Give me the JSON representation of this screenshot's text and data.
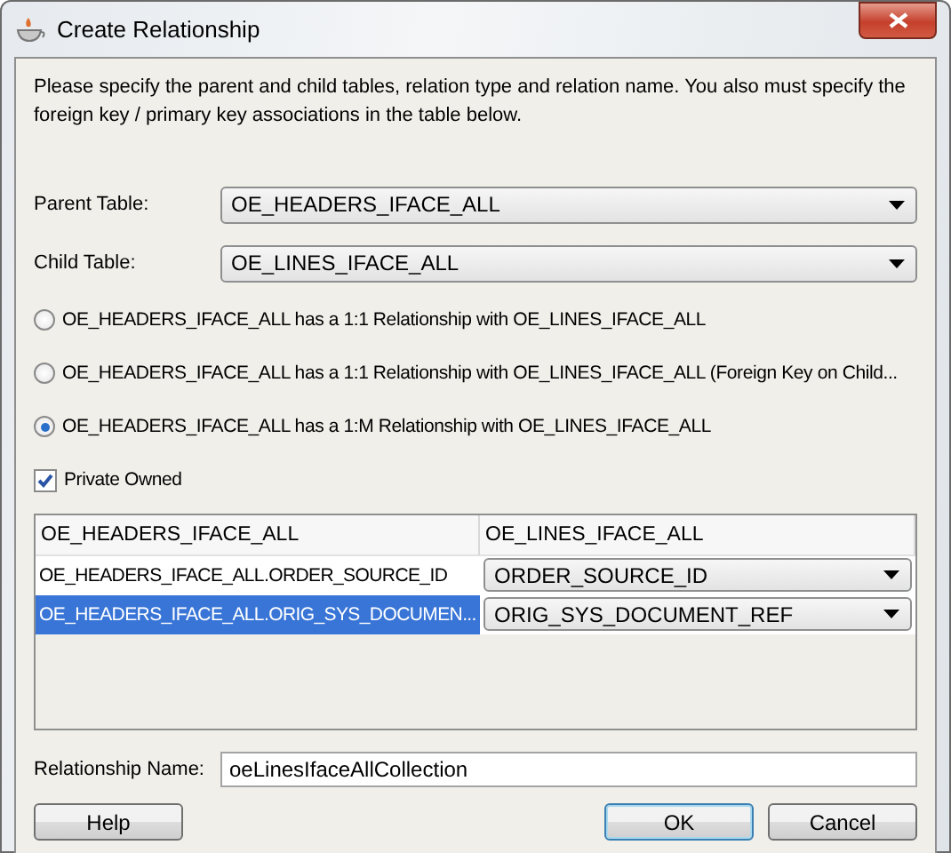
{
  "window": {
    "title": "Create Relationship"
  },
  "instructions": "Please specify the parent and child tables, relation type and relation name.  You also must specify the foreign key / primary key associations in the table below.",
  "parent_table": {
    "label": "Parent Table:",
    "value": "OE_HEADERS_IFACE_ALL"
  },
  "child_table": {
    "label": "Child Table:",
    "value": "OE_LINES_IFACE_ALL"
  },
  "relation_types": [
    {
      "label": "OE_HEADERS_IFACE_ALL has a 1:1 Relationship with OE_LINES_IFACE_ALL",
      "selected": false
    },
    {
      "label": "OE_HEADERS_IFACE_ALL has a 1:1 Relationship with OE_LINES_IFACE_ALL (Foreign Key on Child...",
      "selected": false
    },
    {
      "label": "OE_HEADERS_IFACE_ALL has a 1:M Relationship with OE_LINES_IFACE_ALL",
      "selected": true
    }
  ],
  "private_owned": {
    "label": "Private Owned",
    "checked": true
  },
  "table": {
    "columns": [
      "OE_HEADERS_IFACE_ALL",
      "OE_LINES_IFACE_ALL"
    ],
    "rows": [
      {
        "cells": [
          "OE_HEADERS_IFACE_ALL.ORDER_SOURCE_ID",
          "ORDER_SOURCE_ID"
        ],
        "selected": false
      },
      {
        "cells": [
          "OE_HEADERS_IFACE_ALL.ORIG_SYS_DOCUMEN...",
          "ORIG_SYS_DOCUMENT_REF"
        ],
        "selected": true
      }
    ]
  },
  "relationship_name": {
    "label": "Relationship Name:",
    "value": "oeLinesIfaceAllCollection"
  },
  "buttons": [
    {
      "label": "Help",
      "default": false
    },
    {
      "label": "OK",
      "default": true
    },
    {
      "label": "Cancel",
      "default": false
    }
  ]
}
